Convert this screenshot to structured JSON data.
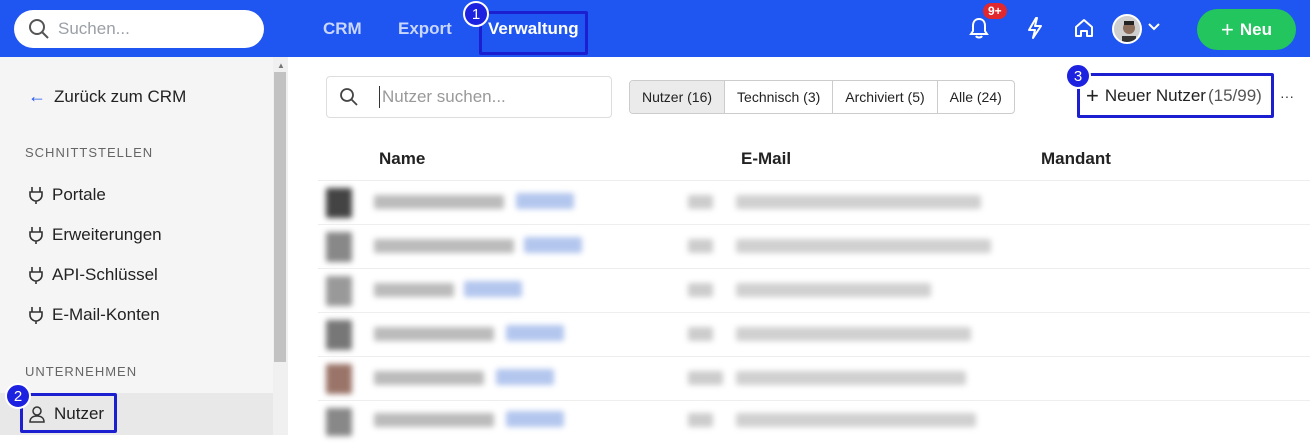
{
  "header": {
    "search_placeholder": "Suchen...",
    "nav": [
      "CRM",
      "Export",
      "Verwaltung"
    ],
    "notification_badge": "9+",
    "new_button": "Neu"
  },
  "markers": [
    "1",
    "2",
    "3"
  ],
  "sidebar": {
    "back": "Zurück zum CRM",
    "section1": "SCHNITTSTELLEN",
    "items1": [
      "Portale",
      "Erweiterungen",
      "API-Schlüssel",
      "E-Mail-Konten"
    ],
    "section2": "UNTERNEHMEN",
    "active_item": "Nutzer"
  },
  "main": {
    "search_placeholder": "Nutzer suchen...",
    "filters": [
      "Nutzer (16)",
      "Technisch (3)",
      "Archiviert (5)",
      "Alle (24)"
    ],
    "new_user": "Neuer Nutzer",
    "new_user_count": "(15/99)",
    "more": "···",
    "columns": [
      "Name",
      "E-Mail",
      "Mandant"
    ]
  },
  "colors": {
    "brand": "#1f55f0",
    "accent": "#22c55e",
    "highlight": "#1c1fd0",
    "badge": "#e0282e"
  }
}
